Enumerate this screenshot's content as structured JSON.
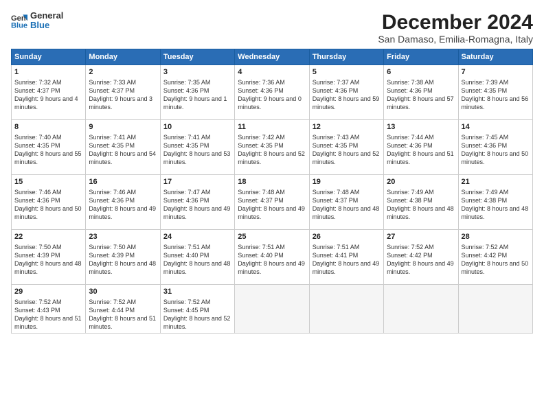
{
  "logo": {
    "general": "General",
    "blue": "Blue"
  },
  "title": "December 2024",
  "subtitle": "San Damaso, Emilia-Romagna, Italy",
  "headers": [
    "Sunday",
    "Monday",
    "Tuesday",
    "Wednesday",
    "Thursday",
    "Friday",
    "Saturday"
  ],
  "weeks": [
    [
      {
        "day": "1",
        "sunrise": "7:32 AM",
        "sunset": "4:37 PM",
        "daylight": "9 hours and 4 minutes."
      },
      {
        "day": "2",
        "sunrise": "7:33 AM",
        "sunset": "4:37 PM",
        "daylight": "9 hours and 3 minutes."
      },
      {
        "day": "3",
        "sunrise": "7:35 AM",
        "sunset": "4:36 PM",
        "daylight": "9 hours and 1 minute."
      },
      {
        "day": "4",
        "sunrise": "7:36 AM",
        "sunset": "4:36 PM",
        "daylight": "9 hours and 0 minutes."
      },
      {
        "day": "5",
        "sunrise": "7:37 AM",
        "sunset": "4:36 PM",
        "daylight": "8 hours and 59 minutes."
      },
      {
        "day": "6",
        "sunrise": "7:38 AM",
        "sunset": "4:36 PM",
        "daylight": "8 hours and 57 minutes."
      },
      {
        "day": "7",
        "sunrise": "7:39 AM",
        "sunset": "4:35 PM",
        "daylight": "8 hours and 56 minutes."
      }
    ],
    [
      {
        "day": "8",
        "sunrise": "7:40 AM",
        "sunset": "4:35 PM",
        "daylight": "8 hours and 55 minutes."
      },
      {
        "day": "9",
        "sunrise": "7:41 AM",
        "sunset": "4:35 PM",
        "daylight": "8 hours and 54 minutes."
      },
      {
        "day": "10",
        "sunrise": "7:41 AM",
        "sunset": "4:35 PM",
        "daylight": "8 hours and 53 minutes."
      },
      {
        "day": "11",
        "sunrise": "7:42 AM",
        "sunset": "4:35 PM",
        "daylight": "8 hours and 52 minutes."
      },
      {
        "day": "12",
        "sunrise": "7:43 AM",
        "sunset": "4:35 PM",
        "daylight": "8 hours and 52 minutes."
      },
      {
        "day": "13",
        "sunrise": "7:44 AM",
        "sunset": "4:36 PM",
        "daylight": "8 hours and 51 minutes."
      },
      {
        "day": "14",
        "sunrise": "7:45 AM",
        "sunset": "4:36 PM",
        "daylight": "8 hours and 50 minutes."
      }
    ],
    [
      {
        "day": "15",
        "sunrise": "7:46 AM",
        "sunset": "4:36 PM",
        "daylight": "8 hours and 50 minutes."
      },
      {
        "day": "16",
        "sunrise": "7:46 AM",
        "sunset": "4:36 PM",
        "daylight": "8 hours and 49 minutes."
      },
      {
        "day": "17",
        "sunrise": "7:47 AM",
        "sunset": "4:36 PM",
        "daylight": "8 hours and 49 minutes."
      },
      {
        "day": "18",
        "sunrise": "7:48 AM",
        "sunset": "4:37 PM",
        "daylight": "8 hours and 49 minutes."
      },
      {
        "day": "19",
        "sunrise": "7:48 AM",
        "sunset": "4:37 PM",
        "daylight": "8 hours and 48 minutes."
      },
      {
        "day": "20",
        "sunrise": "7:49 AM",
        "sunset": "4:38 PM",
        "daylight": "8 hours and 48 minutes."
      },
      {
        "day": "21",
        "sunrise": "7:49 AM",
        "sunset": "4:38 PM",
        "daylight": "8 hours and 48 minutes."
      }
    ],
    [
      {
        "day": "22",
        "sunrise": "7:50 AM",
        "sunset": "4:39 PM",
        "daylight": "8 hours and 48 minutes."
      },
      {
        "day": "23",
        "sunrise": "7:50 AM",
        "sunset": "4:39 PM",
        "daylight": "8 hours and 48 minutes."
      },
      {
        "day": "24",
        "sunrise": "7:51 AM",
        "sunset": "4:40 PM",
        "daylight": "8 hours and 48 minutes."
      },
      {
        "day": "25",
        "sunrise": "7:51 AM",
        "sunset": "4:40 PM",
        "daylight": "8 hours and 49 minutes."
      },
      {
        "day": "26",
        "sunrise": "7:51 AM",
        "sunset": "4:41 PM",
        "daylight": "8 hours and 49 minutes."
      },
      {
        "day": "27",
        "sunrise": "7:52 AM",
        "sunset": "4:42 PM",
        "daylight": "8 hours and 49 minutes."
      },
      {
        "day": "28",
        "sunrise": "7:52 AM",
        "sunset": "4:42 PM",
        "daylight": "8 hours and 50 minutes."
      }
    ],
    [
      {
        "day": "29",
        "sunrise": "7:52 AM",
        "sunset": "4:43 PM",
        "daylight": "8 hours and 51 minutes."
      },
      {
        "day": "30",
        "sunrise": "7:52 AM",
        "sunset": "4:44 PM",
        "daylight": "8 hours and 51 minutes."
      },
      {
        "day": "31",
        "sunrise": "7:52 AM",
        "sunset": "4:45 PM",
        "daylight": "8 hours and 52 minutes."
      },
      null,
      null,
      null,
      null
    ]
  ]
}
